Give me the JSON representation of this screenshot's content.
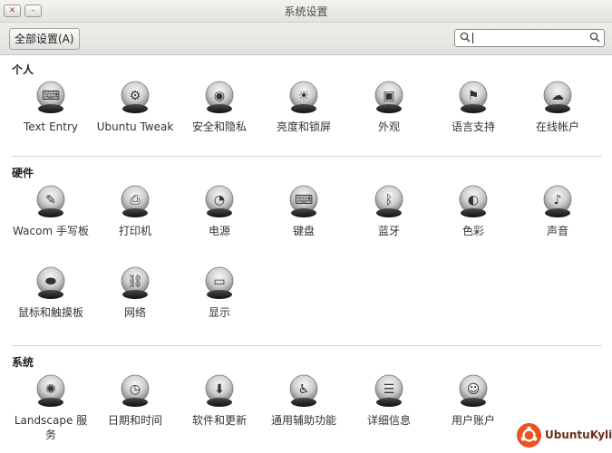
{
  "window": {
    "title": "系统设置"
  },
  "toolbar": {
    "all_settings_label": "全部设置(A)",
    "search_value": ""
  },
  "sections": {
    "personal": {
      "title": "个人",
      "items": [
        {
          "label": "Text Entry",
          "icon": "text-entry-icon"
        },
        {
          "label": "Ubuntu Tweak",
          "icon": "ubuntu-tweak-icon"
        },
        {
          "label": "安全和隐私",
          "icon": "security-privacy-icon"
        },
        {
          "label": "亮度和锁屏",
          "icon": "brightness-lock-icon"
        },
        {
          "label": "外观",
          "icon": "appearance-icon"
        },
        {
          "label": "语言支持",
          "icon": "language-support-icon"
        },
        {
          "label": "在线帐户",
          "icon": "online-accounts-icon"
        }
      ]
    },
    "hardware": {
      "title": "硬件",
      "items": [
        {
          "label": "Wacom 手写板",
          "icon": "wacom-tablet-icon"
        },
        {
          "label": "打印机",
          "icon": "printer-icon"
        },
        {
          "label": "电源",
          "icon": "power-icon"
        },
        {
          "label": "键盘",
          "icon": "keyboard-icon"
        },
        {
          "label": "蓝牙",
          "icon": "bluetooth-icon"
        },
        {
          "label": "色彩",
          "icon": "color-icon"
        },
        {
          "label": "声音",
          "icon": "sound-icon"
        },
        {
          "label": "鼠标和触摸板",
          "icon": "mouse-touchpad-icon"
        },
        {
          "label": "网络",
          "icon": "network-icon"
        },
        {
          "label": "显示",
          "icon": "display-icon"
        }
      ]
    },
    "system": {
      "title": "系统",
      "items": [
        {
          "label": "Landscape 服务",
          "icon": "landscape-icon"
        },
        {
          "label": "日期和时间",
          "icon": "date-time-icon"
        },
        {
          "label": "软件和更新",
          "icon": "software-updates-icon"
        },
        {
          "label": "通用辅助功能",
          "icon": "universal-access-icon"
        },
        {
          "label": "详细信息",
          "icon": "details-icon"
        },
        {
          "label": "用户账户",
          "icon": "user-accounts-icon"
        }
      ]
    }
  },
  "branding": {
    "logo_text": "UbuntuKylin"
  },
  "colors": {
    "accent": "#e95420",
    "sphere_dark": "#2d2d2d"
  }
}
